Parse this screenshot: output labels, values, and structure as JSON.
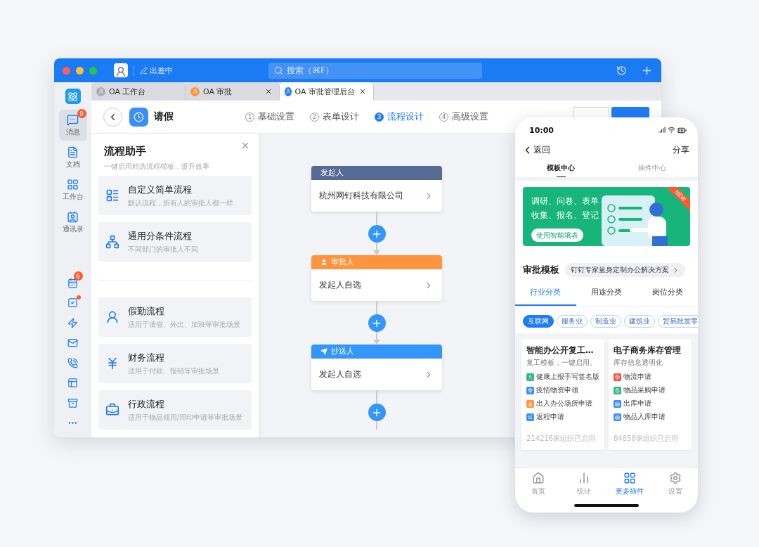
{
  "titlebar": {
    "status": "出差中",
    "search": {
      "placeholder": "搜索（⌘F）"
    }
  },
  "rail": {
    "items": [
      {
        "kind": "chat",
        "label": "消息",
        "badge": "9",
        "selected": true
      },
      {
        "kind": "doc",
        "label": "文档",
        "selected": false
      },
      {
        "kind": "grid",
        "label": "工作台",
        "selected": false
      },
      {
        "kind": "contact",
        "label": "通讯录",
        "selected": false
      }
    ],
    "tools": [
      {
        "kind": "calendar",
        "badge": "6",
        "dot": false
      },
      {
        "kind": "todo",
        "dot": true
      },
      {
        "kind": "bolt",
        "dot": false
      },
      {
        "kind": "mail",
        "dot": false
      },
      {
        "kind": "phone",
        "dot": false
      },
      {
        "kind": "form",
        "dot": false
      },
      {
        "kind": "box",
        "dot": false
      },
      {
        "kind": "more",
        "dot": false
      }
    ]
  },
  "tabs": [
    {
      "label": "OA 工作台",
      "selected": false,
      "closable": false,
      "color": "#a9adb5"
    },
    {
      "label": "OA 审批",
      "selected": false,
      "closable": true,
      "color": "#ff943e"
    },
    {
      "label": "OA 审批管理后台",
      "selected": true,
      "closable": true,
      "color": "#1f7cf5"
    }
  ],
  "header": {
    "title": "请假",
    "steps": [
      {
        "number": "1",
        "label": "基础设置",
        "selected": false
      },
      {
        "number": "2",
        "label": "表单设计",
        "selected": false
      },
      {
        "number": "3",
        "label": "流程设计",
        "selected": true
      },
      {
        "number": "4",
        "label": "高级设置",
        "selected": false
      }
    ],
    "buttons": [
      {
        "kind": "secondary"
      },
      {
        "kind": "primary"
      }
    ]
  },
  "assistant": {
    "title": "流程助手",
    "subtitle": "一键启用精选流程模板，提升效率",
    "groups": [
      {
        "cards": [
          {
            "kind": "list",
            "title": "自定义简单流程",
            "description": "默认流程，所有人的审批人都一样"
          },
          {
            "kind": "branch",
            "title": "通用分条件流程",
            "description": "不同部门的审批人不同"
          }
        ]
      },
      {
        "cards": [
          {
            "kind": "leave",
            "title": "假勤流程",
            "description": "适用于请假、外出、加班等审批场景"
          },
          {
            "kind": "yen",
            "title": "财务流程",
            "description": "适用于付款、报销等审批场景"
          },
          {
            "kind": "toolbox",
            "title": "行政流程",
            "description": "适用于物品领用/用印申请等审批场景"
          }
        ]
      }
    ]
  },
  "flow": {
    "nodes": [
      {
        "kind": "starter",
        "label": "发起人",
        "value": "杭州网钉科技有限公司"
      },
      {
        "kind": "approver",
        "label": "审批人",
        "value": "发起人自选"
      },
      {
        "kind": "cc",
        "label": "抄送人",
        "value": "发起人自选"
      }
    ]
  },
  "phone": {
    "time": "10:00",
    "back": "返回",
    "share": "分享",
    "tabs": [
      {
        "label": "模板中心",
        "selected": true
      },
      {
        "label": "插件中心",
        "selected": false
      }
    ],
    "banner": {
      "lines": [
        "调研、问卷、表单",
        "收集、报名、登记"
      ],
      "button": "使用智能填表",
      "ribbon": "NEW"
    },
    "section": {
      "title": "审批模板",
      "link": "钉钉专家量身定制办公解决方案"
    },
    "categories": [
      {
        "label": "行业分类",
        "selected": true
      },
      {
        "label": "用途分类",
        "selected": false
      },
      {
        "label": "岗位分类",
        "selected": false
      }
    ],
    "chips": [
      {
        "label": "互联网",
        "selected": true
      },
      {
        "label": "服务业",
        "selected": false
      },
      {
        "label": "制造业",
        "selected": false
      },
      {
        "label": "建筑业",
        "selected": false
      },
      {
        "label": "贸易批发零",
        "selected": false
      }
    ],
    "cards": [
      {
        "title": "智能办公开复工…",
        "subtitle": "复工模板，一键启用。",
        "footer": "214216家组织已启用",
        "items": [
          {
            "kind": "user",
            "label": "健康上报手写签名版",
            "color": "#2dba7b"
          },
          {
            "kind": "gem",
            "label": "疫情物资申领",
            "color": "#3d8ef7"
          },
          {
            "kind": "stamp",
            "label": "出入办公场所申请",
            "color": "#ff943e"
          },
          {
            "kind": "plane",
            "label": "返程申请",
            "color": "#3d8ef7"
          }
        ]
      },
      {
        "title": "电子商务库存管理",
        "subtitle": "库存信息透明化",
        "footer": "84858家组织已启用",
        "items": [
          {
            "kind": "package",
            "label": "物流申请",
            "color": "#f25643"
          },
          {
            "kind": "clipboard",
            "label": "物品采购申请",
            "color": "#2dba7b"
          },
          {
            "kind": "warehouse",
            "label": "出库申请",
            "color": "#3d8ef7"
          },
          {
            "kind": "warehouse",
            "label": "物品入库申请",
            "color": "#3d8ef7"
          }
        ]
      }
    ],
    "nav": [
      {
        "kind": "home",
        "label": "首页",
        "selected": false
      },
      {
        "kind": "chart",
        "label": "统计",
        "selected": false
      },
      {
        "kind": "grid",
        "label": "更多插件",
        "selected": true
      },
      {
        "kind": "settings",
        "label": "设置",
        "selected": false
      }
    ]
  }
}
